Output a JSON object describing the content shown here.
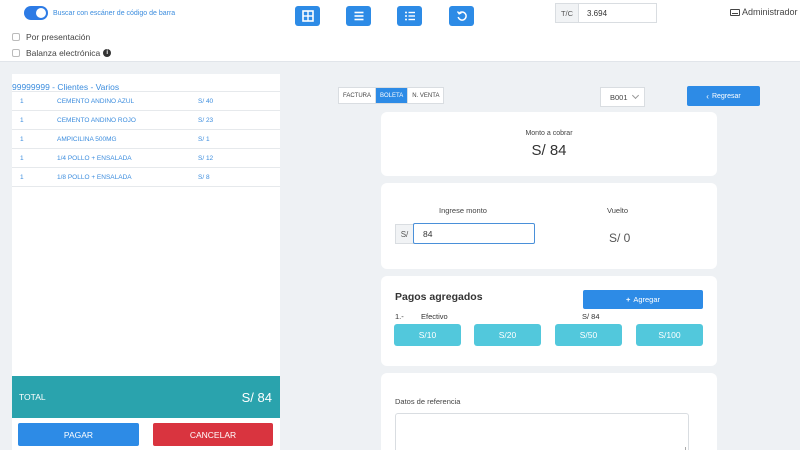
{
  "topbar": {
    "scan_label": "Buscar con escáner de código de barra",
    "por_presentacion": "Por presentación",
    "balanza": "Balanza electrónica",
    "tc_label": "T/C",
    "tc_value": "3.694",
    "user": "Administrador",
    "icons": [
      "grid-icon",
      "list-icon",
      "bullet-list-icon",
      "refresh-icon"
    ]
  },
  "cart": {
    "customer": "99999999 - Clientes - Varios",
    "items": [
      {
        "qty": "1",
        "name": "CEMENTO ANDINO AZUL",
        "price": "S/ 40"
      },
      {
        "qty": "1",
        "name": "CEMENTO ANDINO ROJO",
        "price": "S/ 23"
      },
      {
        "qty": "1",
        "name": "AMPICILINA 500MG",
        "price": "S/ 1"
      },
      {
        "qty": "1",
        "name": "1/4 POLLO + ENSALADA",
        "price": "S/ 12"
      },
      {
        "qty": "1",
        "name": "1/8 POLLO + ENSALADA",
        "price": "S/ 8"
      }
    ],
    "total_label": "TOTAL",
    "total_value": "S/ 84",
    "pay_label": "PAGAR",
    "cancel_label": "CANCELAR"
  },
  "doc": {
    "tabs": [
      "FACTURA",
      "BOLETA",
      "N. VENTA"
    ],
    "active_tab": "BOLETA",
    "series": "B001",
    "back_label": "Regresar"
  },
  "charge": {
    "label": "Monto a cobrar",
    "value": "S/ 84"
  },
  "amount": {
    "label": "Ingrese monto",
    "prefix": "S/",
    "value": "84",
    "change_label": "Vuelto",
    "change_value": "S/ 0"
  },
  "payments": {
    "title": "Pagos agregados",
    "add_label": "Agregar",
    "rows": [
      {
        "index": "1.-",
        "method": "Efectivo",
        "amount": "S/ 84"
      }
    ],
    "quick": [
      "S/10",
      "S/20",
      "S/50",
      "S/100"
    ]
  },
  "reference": {
    "label": "Datos de referencia"
  },
  "colors": {
    "primary": "#2d8be6",
    "teal": "#2aa3ad",
    "danger": "#d9343f",
    "quick": "#52c8dc",
    "link": "#3c8dde"
  }
}
